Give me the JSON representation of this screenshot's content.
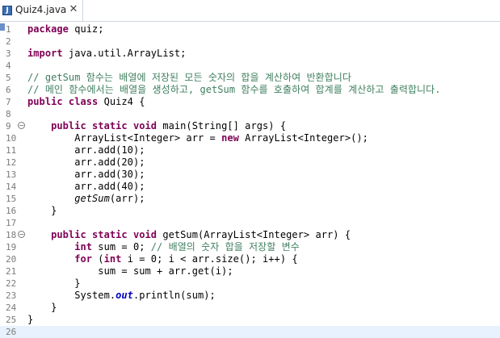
{
  "tab": {
    "icon": "J",
    "title": "Quiz4.java",
    "close": "✕"
  },
  "lines": [
    {
      "n": "1",
      "fold": "",
      "tokens": [
        {
          "t": "package",
          "c": "kw"
        },
        {
          "t": " quiz;",
          "c": ""
        }
      ]
    },
    {
      "n": "2",
      "fold": "",
      "tokens": []
    },
    {
      "n": "3",
      "fold": "",
      "tokens": [
        {
          "t": "import",
          "c": "kw"
        },
        {
          "t": " java.util.ArrayList;",
          "c": ""
        }
      ]
    },
    {
      "n": "4",
      "fold": "",
      "tokens": []
    },
    {
      "n": "5",
      "fold": "",
      "tokens": [
        {
          "t": "// getSum 함수는 배열에 저장된 모든 숫자의 합을 계산하여 반환합니다",
          "c": "cm"
        }
      ]
    },
    {
      "n": "6",
      "fold": "",
      "tokens": [
        {
          "t": "// 메인 함수에서는 배열을 생성하고, getSum 함수를 호출하여 합계를 계산하고 출력합니다.",
          "c": "cm"
        }
      ]
    },
    {
      "n": "7",
      "fold": "",
      "tokens": [
        {
          "t": "public class",
          "c": "kw"
        },
        {
          "t": " Quiz4 {",
          "c": ""
        }
      ]
    },
    {
      "n": "8",
      "fold": "",
      "tokens": []
    },
    {
      "n": "9",
      "fold": "⊖",
      "tokens": [
        {
          "t": "    ",
          "c": ""
        },
        {
          "t": "public static void",
          "c": "kw"
        },
        {
          "t": " main(String[] args) {",
          "c": ""
        }
      ]
    },
    {
      "n": "10",
      "fold": "",
      "tokens": [
        {
          "t": "        ArrayList<Integer> arr = ",
          "c": ""
        },
        {
          "t": "new",
          "c": "kw"
        },
        {
          "t": " ArrayList<Integer>();",
          "c": ""
        }
      ]
    },
    {
      "n": "11",
      "fold": "",
      "tokens": [
        {
          "t": "        arr.add(10);",
          "c": ""
        }
      ]
    },
    {
      "n": "12",
      "fold": "",
      "tokens": [
        {
          "t": "        arr.add(20);",
          "c": ""
        }
      ]
    },
    {
      "n": "13",
      "fold": "",
      "tokens": [
        {
          "t": "        arr.add(30);",
          "c": ""
        }
      ]
    },
    {
      "n": "14",
      "fold": "",
      "tokens": [
        {
          "t": "        arr.add(40);",
          "c": ""
        }
      ]
    },
    {
      "n": "15",
      "fold": "",
      "tokens": [
        {
          "t": "        ",
          "c": ""
        },
        {
          "t": "getSum",
          "c": "mi"
        },
        {
          "t": "(arr);",
          "c": ""
        }
      ]
    },
    {
      "n": "16",
      "fold": "",
      "tokens": [
        {
          "t": "    }",
          "c": ""
        }
      ]
    },
    {
      "n": "17",
      "fold": "",
      "tokens": []
    },
    {
      "n": "18",
      "fold": "⊖",
      "tokens": [
        {
          "t": "    ",
          "c": ""
        },
        {
          "t": "public static void",
          "c": "kw"
        },
        {
          "t": " getSum(ArrayList<Integer> arr) {",
          "c": ""
        }
      ]
    },
    {
      "n": "19",
      "fold": "",
      "tokens": [
        {
          "t": "        ",
          "c": ""
        },
        {
          "t": "int",
          "c": "kw"
        },
        {
          "t": " sum = 0; ",
          "c": ""
        },
        {
          "t": "// 배열의 숫자 합을 저장할 변수",
          "c": "cm"
        }
      ]
    },
    {
      "n": "20",
      "fold": "",
      "tokens": [
        {
          "t": "        ",
          "c": ""
        },
        {
          "t": "for",
          "c": "kw"
        },
        {
          "t": " (",
          "c": ""
        },
        {
          "t": "int",
          "c": "kw"
        },
        {
          "t": " i = 0; i < arr.size(); i++) {",
          "c": ""
        }
      ]
    },
    {
      "n": "21",
      "fold": "",
      "tokens": [
        {
          "t": "            sum = sum + arr.get(i);",
          "c": ""
        }
      ]
    },
    {
      "n": "22",
      "fold": "",
      "tokens": [
        {
          "t": "        }",
          "c": ""
        }
      ]
    },
    {
      "n": "23",
      "fold": "",
      "tokens": [
        {
          "t": "        System.",
          "c": ""
        },
        {
          "t": "out",
          "c": "fld"
        },
        {
          "t": ".println(sum);",
          "c": ""
        }
      ]
    },
    {
      "n": "24",
      "fold": "",
      "tokens": [
        {
          "t": "    }",
          "c": ""
        }
      ]
    },
    {
      "n": "25",
      "fold": "",
      "tokens": [
        {
          "t": "}",
          "c": ""
        }
      ]
    },
    {
      "n": "26",
      "fold": "",
      "tokens": []
    }
  ],
  "colors": {
    "keyword": "#7f0055",
    "comment": "#3f7f5f",
    "field": "#0000c0",
    "current_line": "#e8f2fe"
  },
  "icons": {
    "tab": "java-file-icon",
    "close": "close-icon",
    "fold": "collapse-icon"
  }
}
